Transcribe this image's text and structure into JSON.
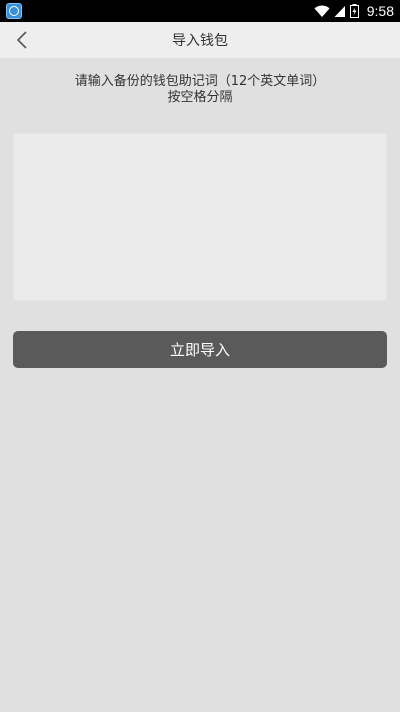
{
  "status_bar": {
    "time": "9:58",
    "icons": [
      "app-icon",
      "wifi-icon",
      "signal-icon",
      "battery-icon"
    ]
  },
  "header": {
    "title": "导入钱包",
    "back_icon": "chevron-left-icon"
  },
  "instruction": {
    "line1": "请输入备份的钱包助记词（12个英文单词）",
    "line2": "按空格分隔"
  },
  "mnemonic_input": {
    "value": "",
    "placeholder": ""
  },
  "import_button": {
    "label": "立即导入"
  },
  "colors": {
    "background": "#e0e0e0",
    "header": "#eeeeee",
    "button": "#5a5a5a",
    "status_bar": "#000000"
  }
}
